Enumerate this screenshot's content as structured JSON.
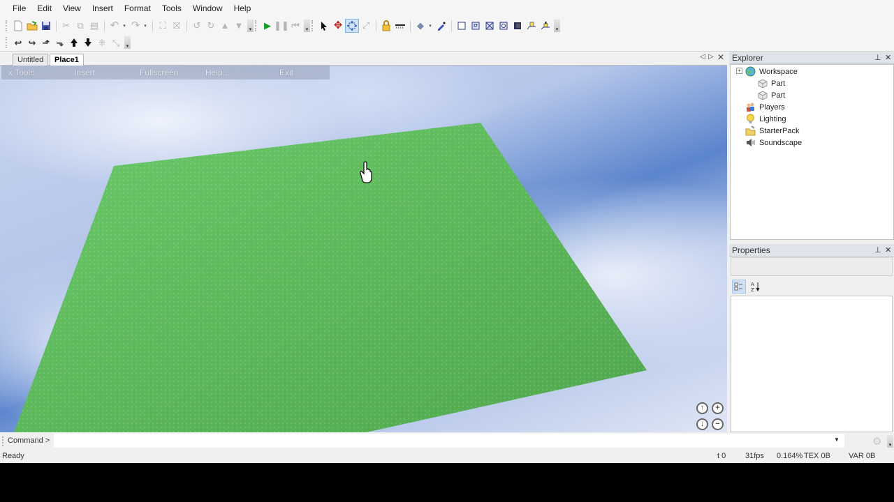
{
  "menubar": {
    "items": [
      "File",
      "Edit",
      "View",
      "Insert",
      "Format",
      "Tools",
      "Window",
      "Help"
    ]
  },
  "toolbar": {
    "row1": [
      {
        "name": "new-icon",
        "glyph": "🗋"
      },
      {
        "name": "open-icon",
        "glyph": "📂"
      },
      {
        "name": "save-icon",
        "glyph": "💾"
      },
      {
        "name": "cut-icon",
        "glyph": "✂"
      },
      {
        "name": "copy-icon",
        "glyph": "⧉"
      },
      {
        "name": "paste-icon",
        "glyph": "📋"
      },
      {
        "name": "undo-icon",
        "glyph": "↶"
      },
      {
        "name": "redo-icon",
        "glyph": "↷"
      },
      {
        "name": "group-icon",
        "glyph": "⛶"
      },
      {
        "name": "ungroup-icon",
        "glyph": "⛶"
      },
      {
        "name": "rotate-left-icon",
        "glyph": "⟲"
      },
      {
        "name": "rotate-right-icon",
        "glyph": "⟳"
      },
      {
        "name": "move-up-icon",
        "glyph": "▲"
      },
      {
        "name": "move-down-icon",
        "glyph": "▼"
      },
      {
        "name": "play-icon",
        "glyph": "▶"
      },
      {
        "name": "pause-icon",
        "glyph": "⏸"
      },
      {
        "name": "stop-icon",
        "glyph": "⏮"
      },
      {
        "name": "select-icon",
        "glyph": "➤"
      },
      {
        "name": "move-icon",
        "glyph": "✥"
      },
      {
        "name": "resize-icon",
        "glyph": "⊹"
      },
      {
        "name": "scale-icon",
        "glyph": "⤢"
      },
      {
        "name": "lock-icon",
        "glyph": "🔒"
      },
      {
        "name": "anchor-icon",
        "glyph": "▬"
      },
      {
        "name": "paint-icon",
        "glyph": "🪣"
      },
      {
        "name": "dropper-icon",
        "glyph": "✎"
      },
      {
        "name": "surface-smooth-icon",
        "glyph": "☐"
      },
      {
        "name": "surface-glue-icon",
        "glyph": "⧇"
      },
      {
        "name": "surface-weld-icon",
        "glyph": "⊠"
      },
      {
        "name": "surface-studs-icon",
        "glyph": "⧈"
      },
      {
        "name": "surface-inlet-icon",
        "glyph": "◼"
      },
      {
        "name": "surface-hinge-icon",
        "glyph": "⏏"
      },
      {
        "name": "surface-motor-icon",
        "glyph": "⏏"
      }
    ],
    "row2": [
      {
        "name": "camera-pan-left-icon",
        "glyph": "↩"
      },
      {
        "name": "camera-pan-right-icon",
        "glyph": "↪"
      },
      {
        "name": "camera-tilt-up-icon",
        "glyph": "⮥"
      },
      {
        "name": "camera-tilt-down-icon",
        "glyph": "⮧"
      },
      {
        "name": "camera-zoom-in-icon",
        "glyph": "⯅"
      },
      {
        "name": "camera-zoom-out-icon",
        "glyph": "🡇"
      },
      {
        "name": "zoom-extents-icon",
        "glyph": "⁜"
      },
      {
        "name": "look-at-icon",
        "glyph": "⤡"
      }
    ]
  },
  "document_tabs": [
    {
      "label": "Untitled",
      "active": false
    },
    {
      "label": "Place1",
      "active": true
    }
  ],
  "viewport": {
    "menu": [
      "x Tools",
      "Insert",
      "Fullscreen",
      "Help...",
      "Exit"
    ],
    "baseplate_color": "#5cb85a",
    "nav_buttons": [
      {
        "name": "camera-up-icon",
        "glyph": "↑"
      },
      {
        "name": "zoom-in-icon",
        "glyph": "+"
      },
      {
        "name": "camera-down-icon",
        "glyph": "↓"
      },
      {
        "name": "zoom-out-icon",
        "glyph": "−"
      }
    ]
  },
  "explorer": {
    "title": "Explorer",
    "items": [
      {
        "label": "Workspace",
        "icon": "globe-icon",
        "level": 0,
        "expandable": true
      },
      {
        "label": "Part",
        "icon": "part-brick-icon",
        "level": 1
      },
      {
        "label": "Part",
        "icon": "part-brick-icon",
        "level": 1
      },
      {
        "label": "Players",
        "icon": "players-icon",
        "level": 0
      },
      {
        "label": "Lighting",
        "icon": "lightbulb-icon",
        "level": 0
      },
      {
        "label": "StarterPack",
        "icon": "folder-icon",
        "level": 0
      },
      {
        "label": "Soundscape",
        "icon": "speaker-icon",
        "level": 0
      }
    ]
  },
  "properties": {
    "title": "Properties",
    "sort_categorized_label": "Categorized",
    "sort_alpha_label": "A-Z"
  },
  "command": {
    "label": "Command >",
    "value": ""
  },
  "status": {
    "ready": "Ready",
    "t": "t 0",
    "fps": "31fps",
    "percent": "0.164%",
    "tex": "TEX 0B",
    "var": "VAR 0B"
  }
}
